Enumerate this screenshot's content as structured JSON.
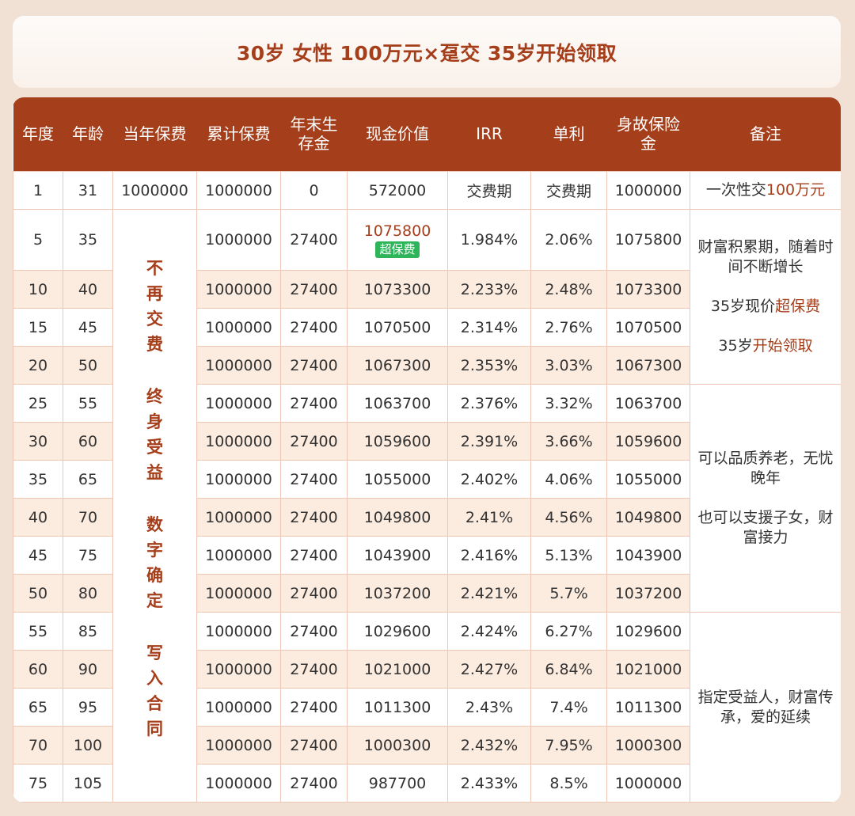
{
  "title": "30岁 女性 100万元×趸交 35岁开始领取",
  "headers": [
    "年度",
    "年龄",
    "当年保费",
    "累计保费",
    "年末生存金",
    "现金价值",
    "IRR",
    "单利",
    "身故保险金",
    "备注"
  ],
  "header_lines": {
    "h4a": "年末生",
    "h4b": "存金",
    "h8a": "身故保险",
    "h8b": "金"
  },
  "row1": {
    "year": "1",
    "age": "31",
    "premium": "1000000",
    "cumulative": "1000000",
    "survival": "0",
    "cash": "572000",
    "irr": "交费期",
    "simple": "交费期",
    "death": "1000000",
    "note_a": "一次性交",
    "note_b": "100万元"
  },
  "rows": [
    {
      "year": "5",
      "age": "35",
      "cumulative": "1000000",
      "survival": "27400",
      "cash": "1075800",
      "irr": "1.984%",
      "simple": "2.06%",
      "death": "1075800"
    },
    {
      "year": "10",
      "age": "40",
      "cumulative": "1000000",
      "survival": "27400",
      "cash": "1073300",
      "irr": "2.233%",
      "simple": "2.48%",
      "death": "1073300"
    },
    {
      "year": "15",
      "age": "45",
      "cumulative": "1000000",
      "survival": "27400",
      "cash": "1070500",
      "irr": "2.314%",
      "simple": "2.76%",
      "death": "1070500"
    },
    {
      "year": "20",
      "age": "50",
      "cumulative": "1000000",
      "survival": "27400",
      "cash": "1067300",
      "irr": "2.353%",
      "simple": "3.03%",
      "death": "1067300"
    },
    {
      "year": "25",
      "age": "55",
      "cumulative": "1000000",
      "survival": "27400",
      "cash": "1063700",
      "irr": "2.376%",
      "simple": "3.32%",
      "death": "1063700"
    },
    {
      "year": "30",
      "age": "60",
      "cumulative": "1000000",
      "survival": "27400",
      "cash": "1059600",
      "irr": "2.391%",
      "simple": "3.66%",
      "death": "1059600"
    },
    {
      "year": "35",
      "age": "65",
      "cumulative": "1000000",
      "survival": "27400",
      "cash": "1055000",
      "irr": "2.402%",
      "simple": "4.06%",
      "death": "1055000"
    },
    {
      "year": "40",
      "age": "70",
      "cumulative": "1000000",
      "survival": "27400",
      "cash": "1049800",
      "irr": "2.41%",
      "simple": "4.56%",
      "death": "1049800"
    },
    {
      "year": "45",
      "age": "75",
      "cumulative": "1000000",
      "survival": "27400",
      "cash": "1043900",
      "irr": "2.416%",
      "simple": "5.13%",
      "death": "1043900"
    },
    {
      "year": "50",
      "age": "80",
      "cumulative": "1000000",
      "survival": "27400",
      "cash": "1037200",
      "irr": "2.421%",
      "simple": "5.7%",
      "death": "1037200"
    },
    {
      "year": "55",
      "age": "85",
      "cumulative": "1000000",
      "survival": "27400",
      "cash": "1029600",
      "irr": "2.424%",
      "simple": "6.27%",
      "death": "1029600"
    },
    {
      "year": "60",
      "age": "90",
      "cumulative": "1000000",
      "survival": "27400",
      "cash": "1021000",
      "irr": "2.427%",
      "simple": "6.84%",
      "death": "1021000"
    },
    {
      "year": "65",
      "age": "95",
      "cumulative": "1000000",
      "survival": "27400",
      "cash": "1011300",
      "irr": "2.43%",
      "simple": "7.4%",
      "death": "1011300"
    },
    {
      "year": "70",
      "age": "100",
      "cumulative": "1000000",
      "survival": "27400",
      "cash": "1000300",
      "irr": "2.432%",
      "simple": "7.95%",
      "death": "1000300"
    },
    {
      "year": "75",
      "age": "105",
      "cumulative": "1000000",
      "survival": "27400",
      "cash": "987700",
      "irr": "2.433%",
      "simple": "8.5%",
      "death": "1000000"
    }
  ],
  "badge": "超保费",
  "vertical": {
    "g1": [
      "不",
      "再",
      "交",
      "费"
    ],
    "g2": [
      "终",
      "身",
      "受",
      "益"
    ],
    "g3": [
      "数",
      "字",
      "确",
      "定"
    ],
    "g4": [
      "写",
      "入",
      "合",
      "同"
    ]
  },
  "notes": {
    "n1": "财富积累期，随着时间不断增长",
    "n2a": "35岁现价",
    "n2b": "超保费",
    "n3a": "35岁",
    "n3b": "开始领取",
    "n4": "可以品质养老，无忧晚年",
    "n5": "也可以支援子女，财富接力",
    "n6": "指定受益人，财富传承，爱的延续"
  },
  "colors": {
    "accent": "#a53e1a",
    "row_alt": "#fcebdf",
    "border": "#eec6b6",
    "badge": "#2eb55a",
    "background": "#f1e1d4"
  }
}
